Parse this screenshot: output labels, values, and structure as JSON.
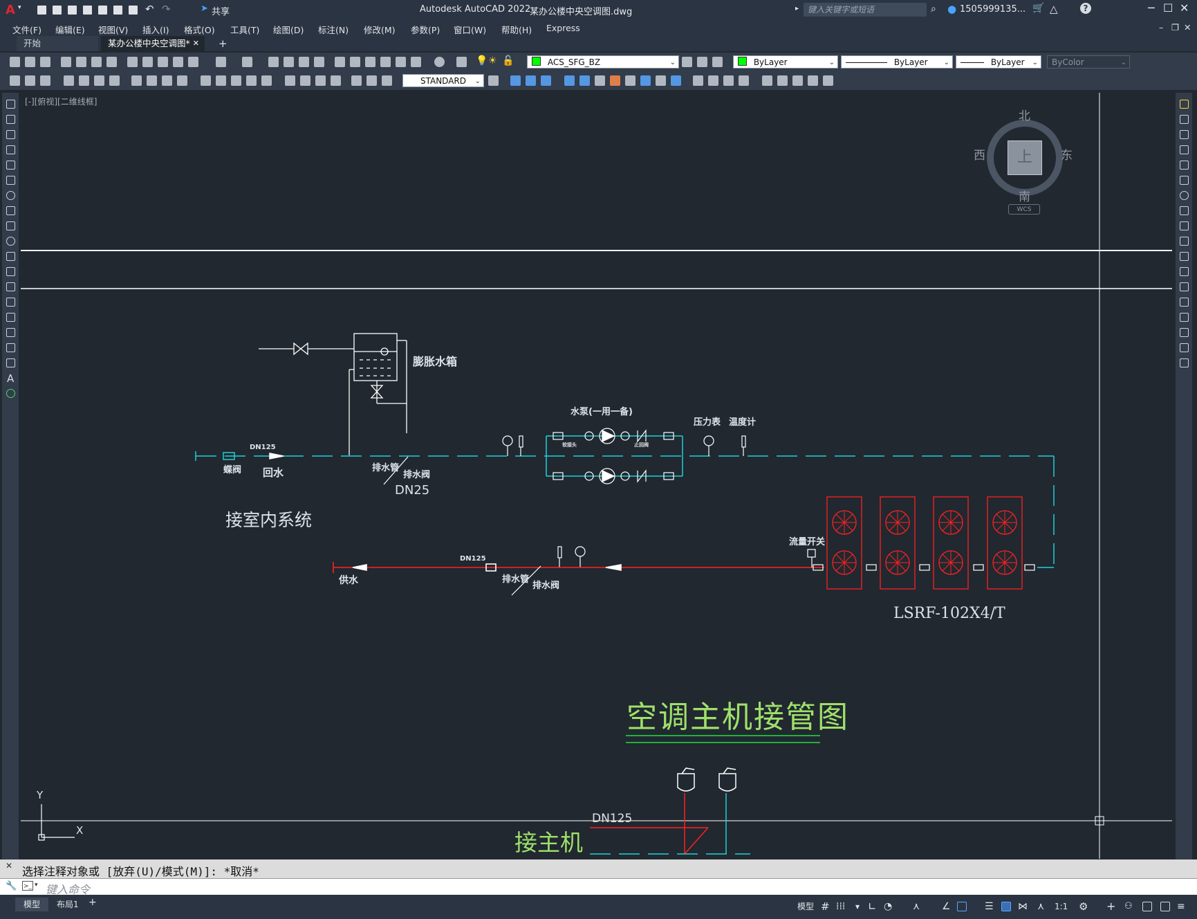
{
  "app": {
    "logo": "A",
    "title": "Autodesk AutoCAD 2022",
    "document": "某办公楼中央空调图.dwg",
    "share_label": "共享",
    "search_placeholder": "键入关键字或短语",
    "user": "1505999135...",
    "help_icon": "?"
  },
  "menu": [
    "文件(F)",
    "编辑(E)",
    "视图(V)",
    "插入(I)",
    "格式(O)",
    "工具(T)",
    "绘图(D)",
    "标注(N)",
    "修改(M)",
    "参数(P)",
    "窗口(W)",
    "帮助(H)",
    "Express"
  ],
  "tabs": [
    {
      "label": "开始",
      "active": false
    },
    {
      "label": "某办公楼中央空调图*",
      "active": true,
      "close": "✕"
    }
  ],
  "tab_add": "+",
  "properties": {
    "layer": "ACS_SFG_BZ",
    "layer_color": "#00ff00",
    "color": "ByLayer",
    "linetype": "ByLayer",
    "lineweight": "ByLayer",
    "plotstyle": "ByColor",
    "textstyle": "STANDARD"
  },
  "viewport": {
    "label": "[-][俯视][二维线框]"
  },
  "viewcube": {
    "north": "北",
    "south": "南",
    "east": "东",
    "west": "西",
    "top": "上",
    "wcs": "WCS"
  },
  "ucs": {
    "x": "X",
    "y": "Y"
  },
  "drawing": {
    "expansion_tank": "膨胀水箱",
    "pump_title": "水泵(一用一备)",
    "pressure_gauge": "压力表",
    "thermometer": "温度计",
    "dn125_return": "DN125",
    "dn125_supply": "DN125",
    "dn25": "DN25",
    "gate_valve": "蝶阀",
    "return_water": "回水",
    "drain_pipe_1": "排水管",
    "drain_valve_1": "排水阀",
    "drain_pipe_2": "排水管",
    "drain_valve_2": "排水阀",
    "indoor_system": "接室内系统",
    "supply_water": "供水",
    "flow_switch": "流量开关",
    "soft_joint": "软接头",
    "check_valve": "止回阀",
    "model": "LSRF-102X4/T",
    "main_title": "空调主机接管图",
    "dn125_bottom": "DN125",
    "host_connect": "接主机"
  },
  "command": {
    "history": "选择注释对象或 [放弃(U)/模式(M)]: *取消*",
    "placeholder": "键入命令"
  },
  "layout_tabs": [
    "模型",
    "布局1"
  ],
  "layout_add": "+",
  "status": {
    "model": "模型",
    "scale": "1:1"
  }
}
